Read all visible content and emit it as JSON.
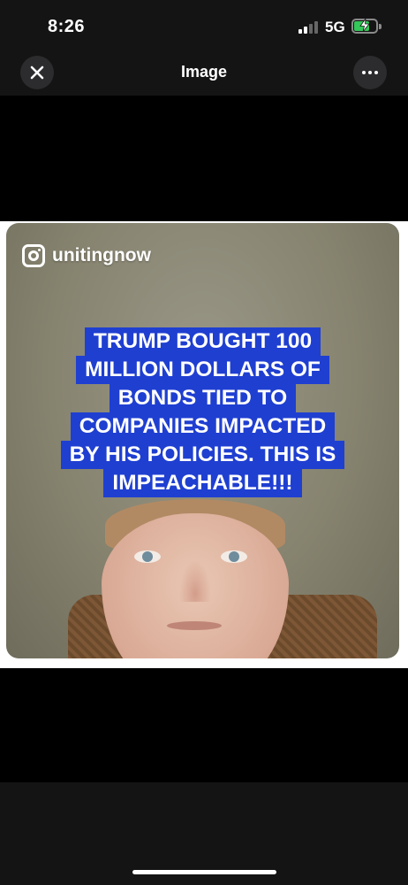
{
  "status_bar": {
    "time": "8:26",
    "network": "5G",
    "battery_level": 0.72,
    "battery_color": "#34c759"
  },
  "nav": {
    "title": "Image",
    "close_icon": "close-icon",
    "more_icon": "more-icon"
  },
  "image": {
    "source_handle": "unitingnow",
    "source_icon": "instagram-icon",
    "caption_lines": [
      "TRUMP BOUGHT 100",
      "MILLION DOLLARS OF",
      "BONDS TIED TO",
      "COMPANIES IMPACTED",
      "BY HIS POLICIES. THIS IS",
      "IMPEACHABLE!!!"
    ],
    "caption_bg": "#1f3fd1"
  }
}
